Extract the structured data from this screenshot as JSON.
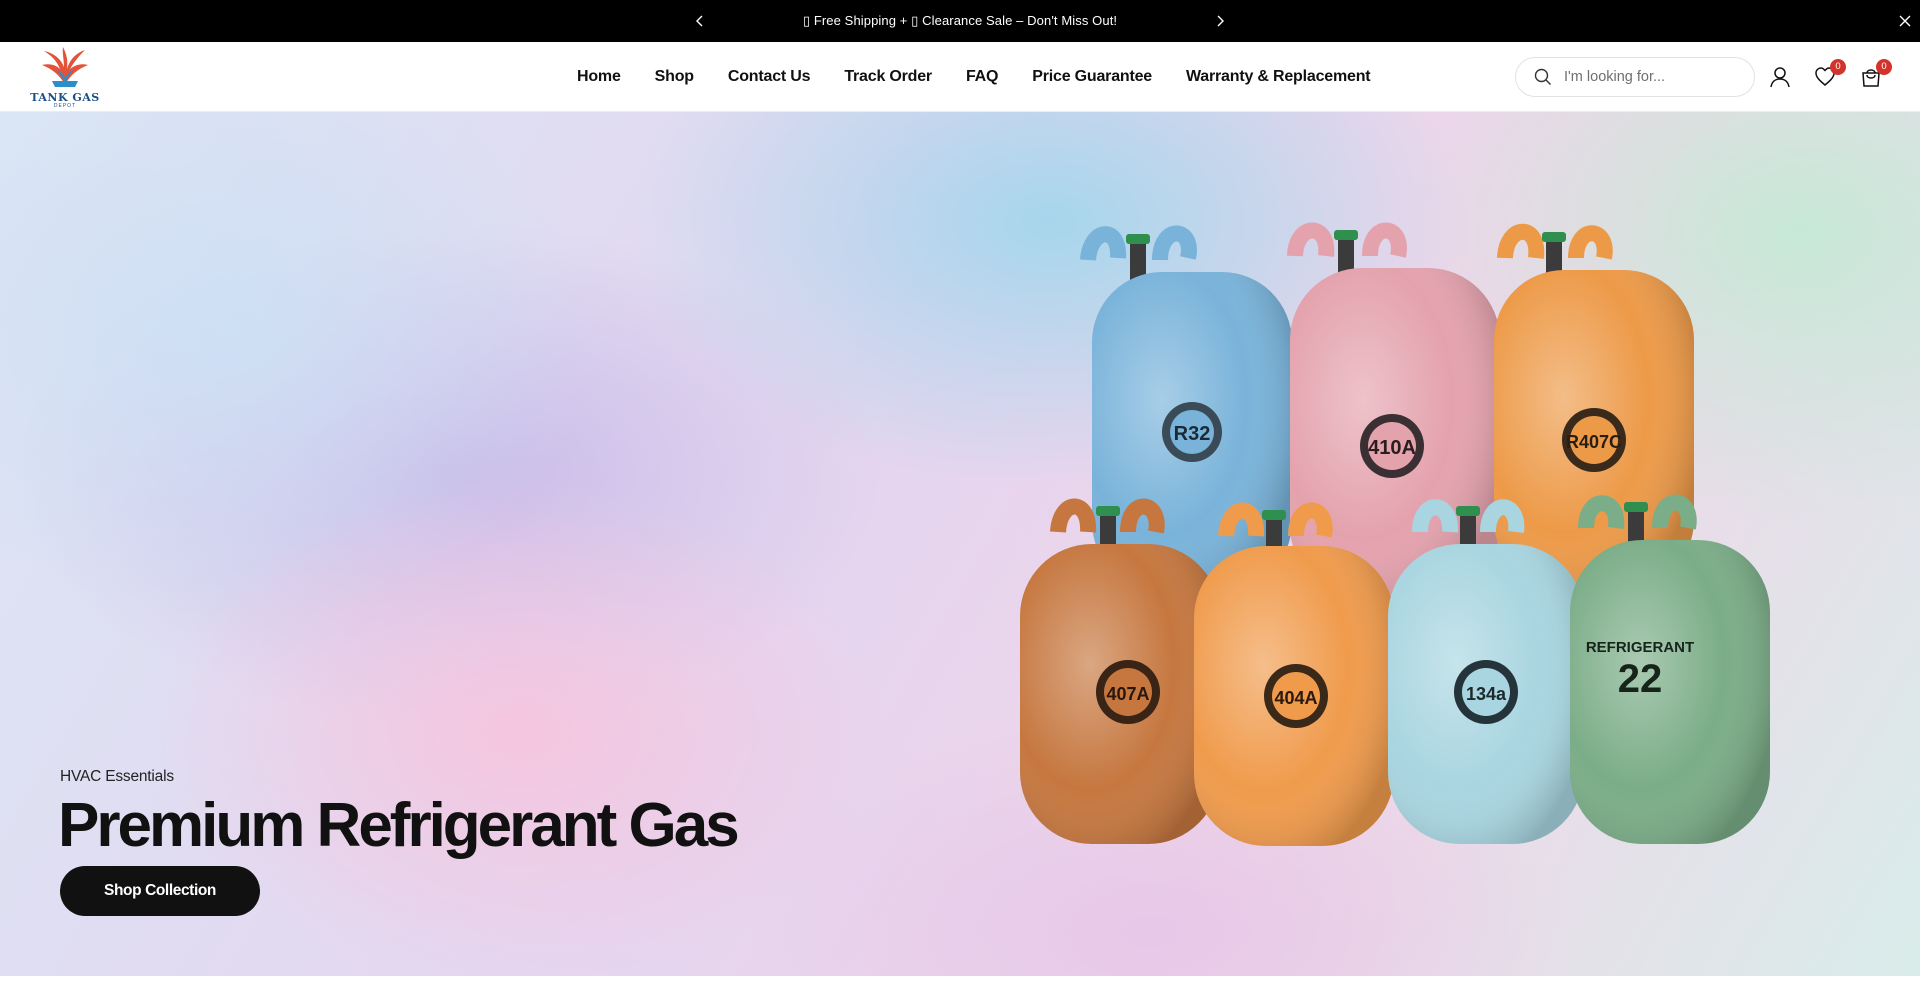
{
  "announcement": {
    "text": "▯ Free Shipping + ▯ Clearance Sale – Don't Miss Out!"
  },
  "header": {
    "logo_text": "TANK GAS",
    "logo_sub": "DEPOT",
    "nav": [
      "Home",
      "Shop",
      "Contact Us",
      "Track Order",
      "FAQ",
      "Price Guarantee",
      "Warranty & Replacement"
    ],
    "search_placeholder": "I'm looking for...",
    "wishlist_count": "0",
    "cart_count": "0"
  },
  "hero": {
    "subtitle": "HVAC Essentials",
    "title": "Premium Refrigerant Gas",
    "button_label": "Shop Collection"
  },
  "product_image": {
    "tank_labels": [
      "R32",
      "410A",
      "R407C",
      "407A",
      "404A",
      "134a",
      "22"
    ],
    "tank_text": "REFRIGERANT",
    "tank_colors": [
      "#79b3da",
      "#e4a2ad",
      "#ed9a48",
      "#c6773f",
      "#f09b4c",
      "#a8d5e0",
      "#7bad88"
    ]
  },
  "colors": {
    "accent": "#111111",
    "badge": "#d2342b"
  }
}
